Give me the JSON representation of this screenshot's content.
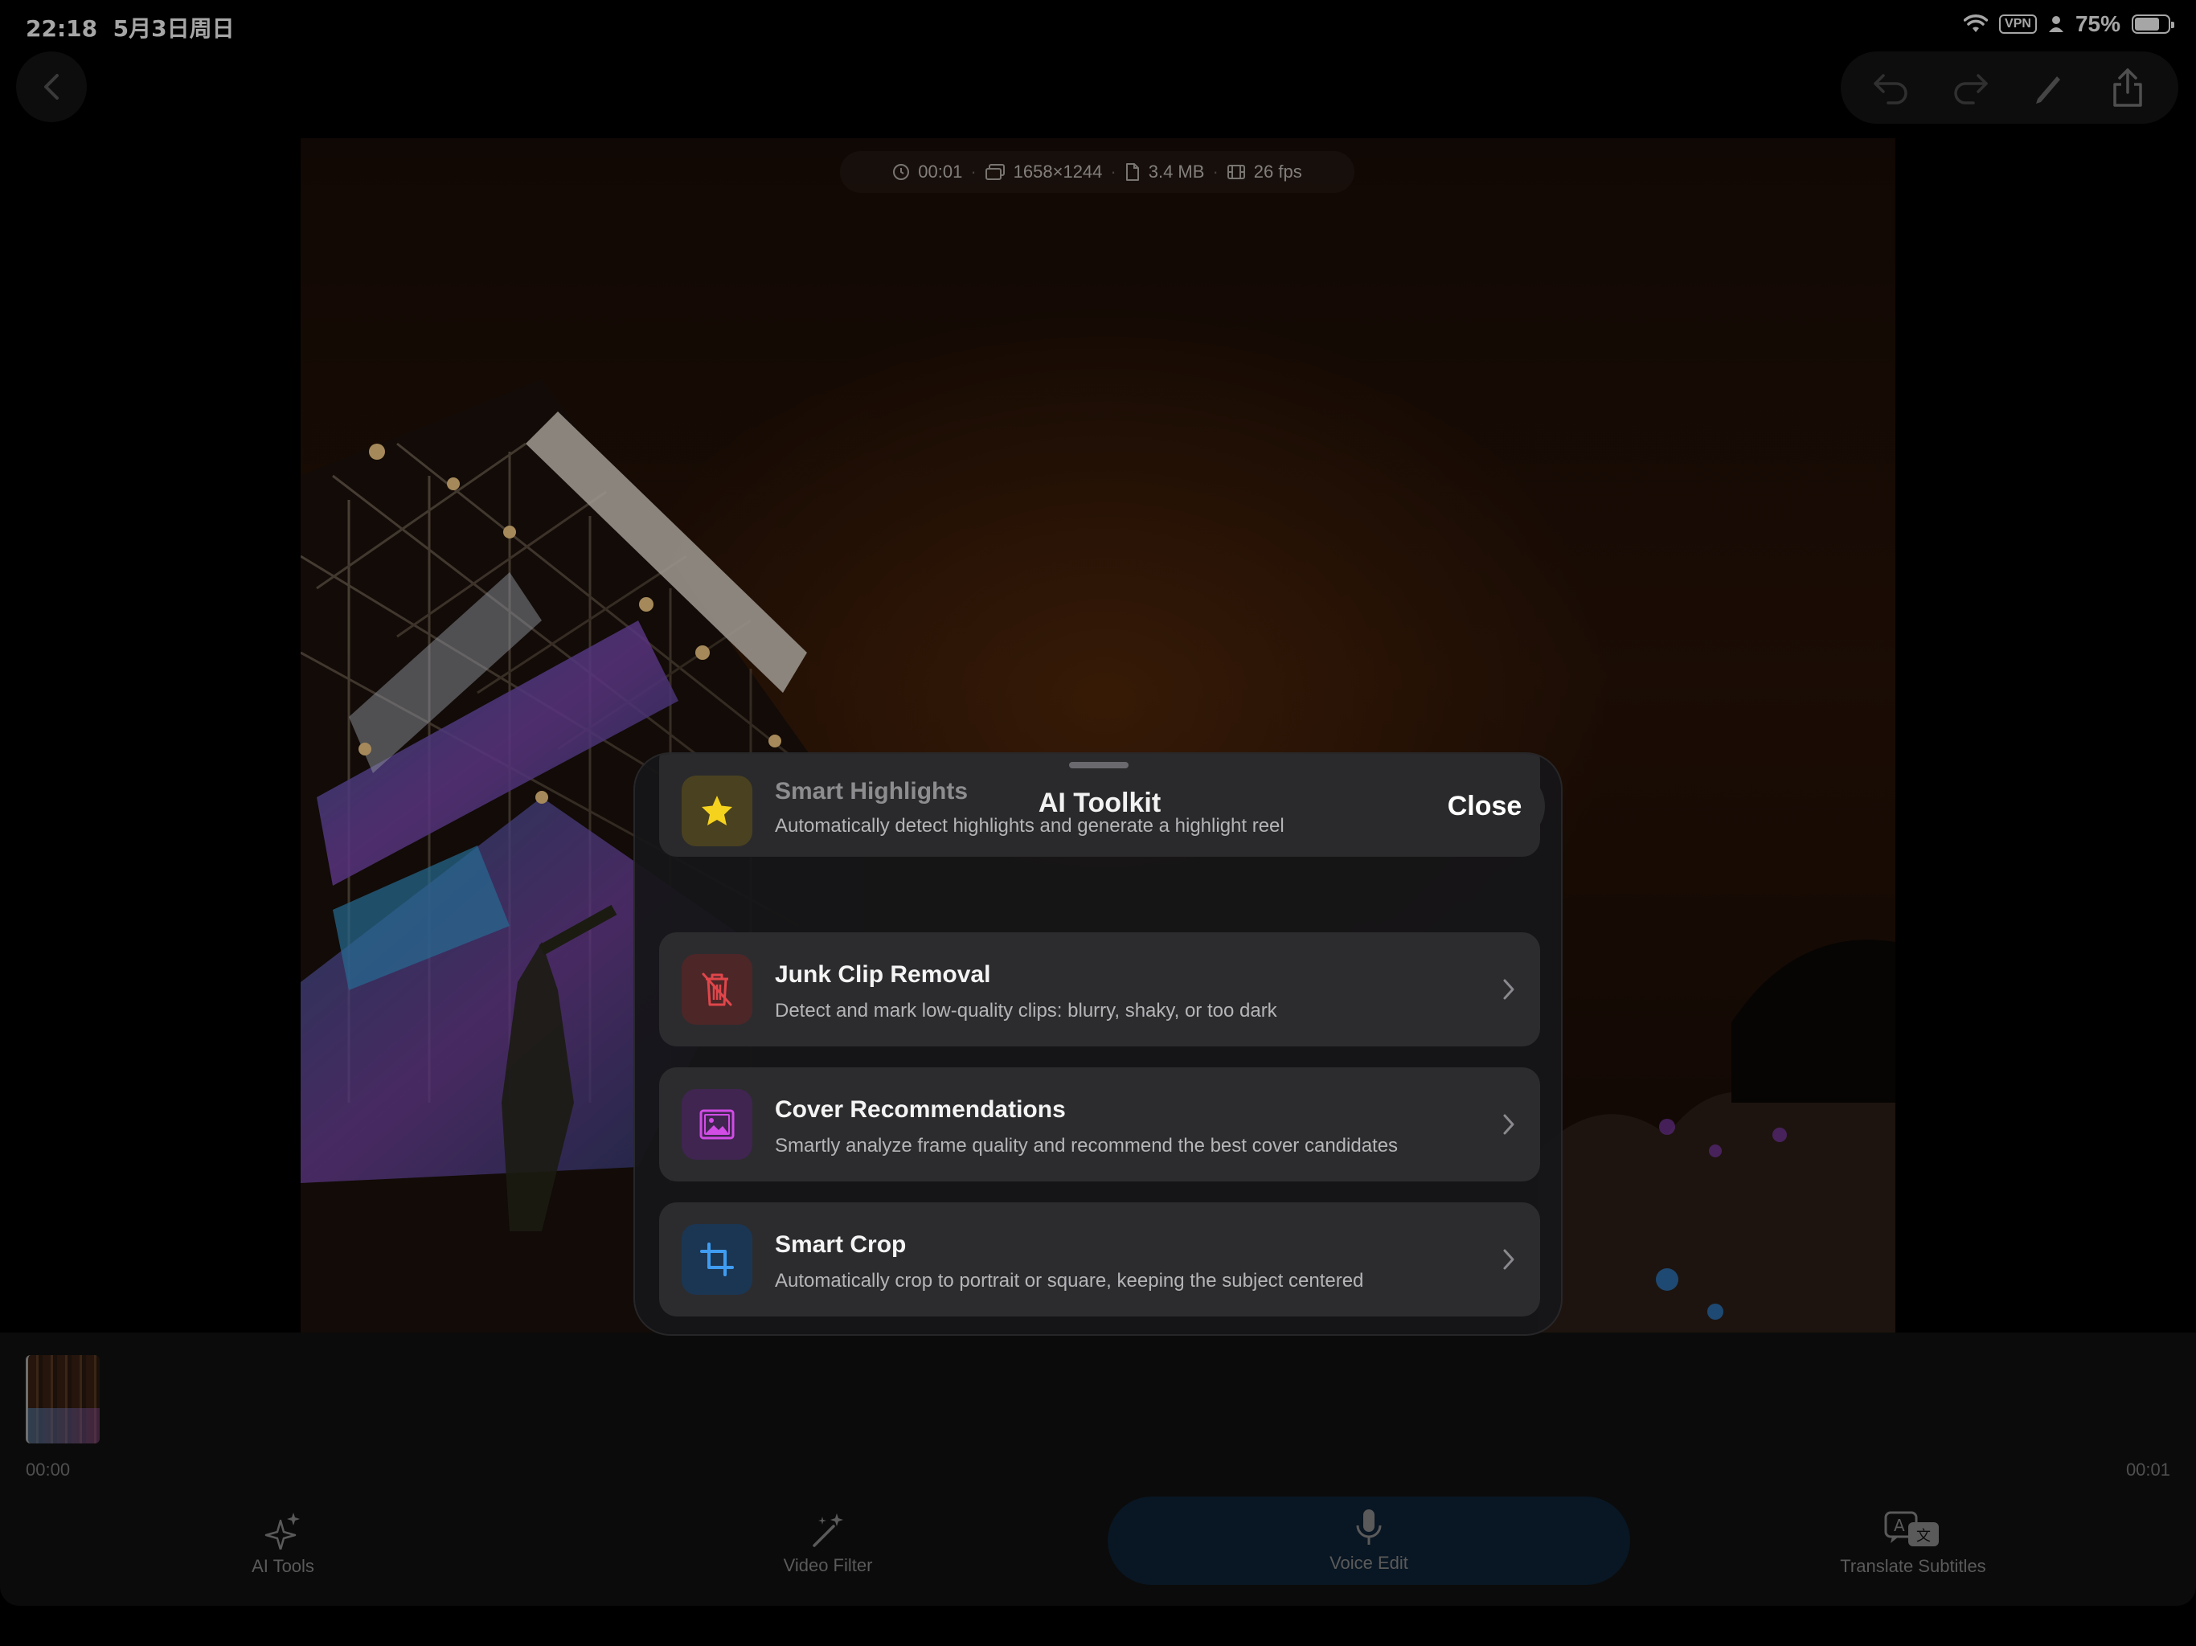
{
  "status_bar": {
    "time": "22:18",
    "date": "5月3日周日",
    "vpn": "VPN",
    "battery_percent": "75%",
    "battery_level": 0.75
  },
  "video_info": {
    "duration": "00:01",
    "resolution": "1658×1244",
    "size": "3.4 MB",
    "fps": "26 fps"
  },
  "sheet": {
    "title": "AI Toolkit",
    "close_label": "Close",
    "items": [
      {
        "title": "Smart Highlights",
        "desc": "Automatically detect highlights and generate a highlight reel",
        "icon": "star-icon",
        "color": "#f5d21d"
      },
      {
        "title": "Junk Clip Removal",
        "desc": "Detect and mark low-quality clips: blurry, shaky, or too dark",
        "icon": "trash-icon",
        "color": "#e0464a"
      },
      {
        "title": "Cover Recommendations",
        "desc": "Smartly analyze frame quality and recommend the best cover candidates",
        "icon": "image-icon",
        "color": "#d24ce6"
      },
      {
        "title": "Smart Crop",
        "desc": "Automatically crop to portrait or square, keeping the subject centered",
        "icon": "crop-icon",
        "color": "#3f9cf0"
      }
    ]
  },
  "timeline": {
    "start": "00:00",
    "end": "00:01"
  },
  "tabs": [
    {
      "label": "AI Tools",
      "icon": "sparkles-icon"
    },
    {
      "label": "Video Filter",
      "icon": "magic-wand-icon"
    },
    {
      "label": "Voice Edit",
      "icon": "microphone-icon"
    },
    {
      "label": "Translate Subtitles",
      "icon": "translate-icon"
    }
  ],
  "colors": {
    "background": "#000000",
    "sheet": "#161618",
    "card": "#2c2c2f",
    "voice_tab_active": "#0f2336"
  }
}
